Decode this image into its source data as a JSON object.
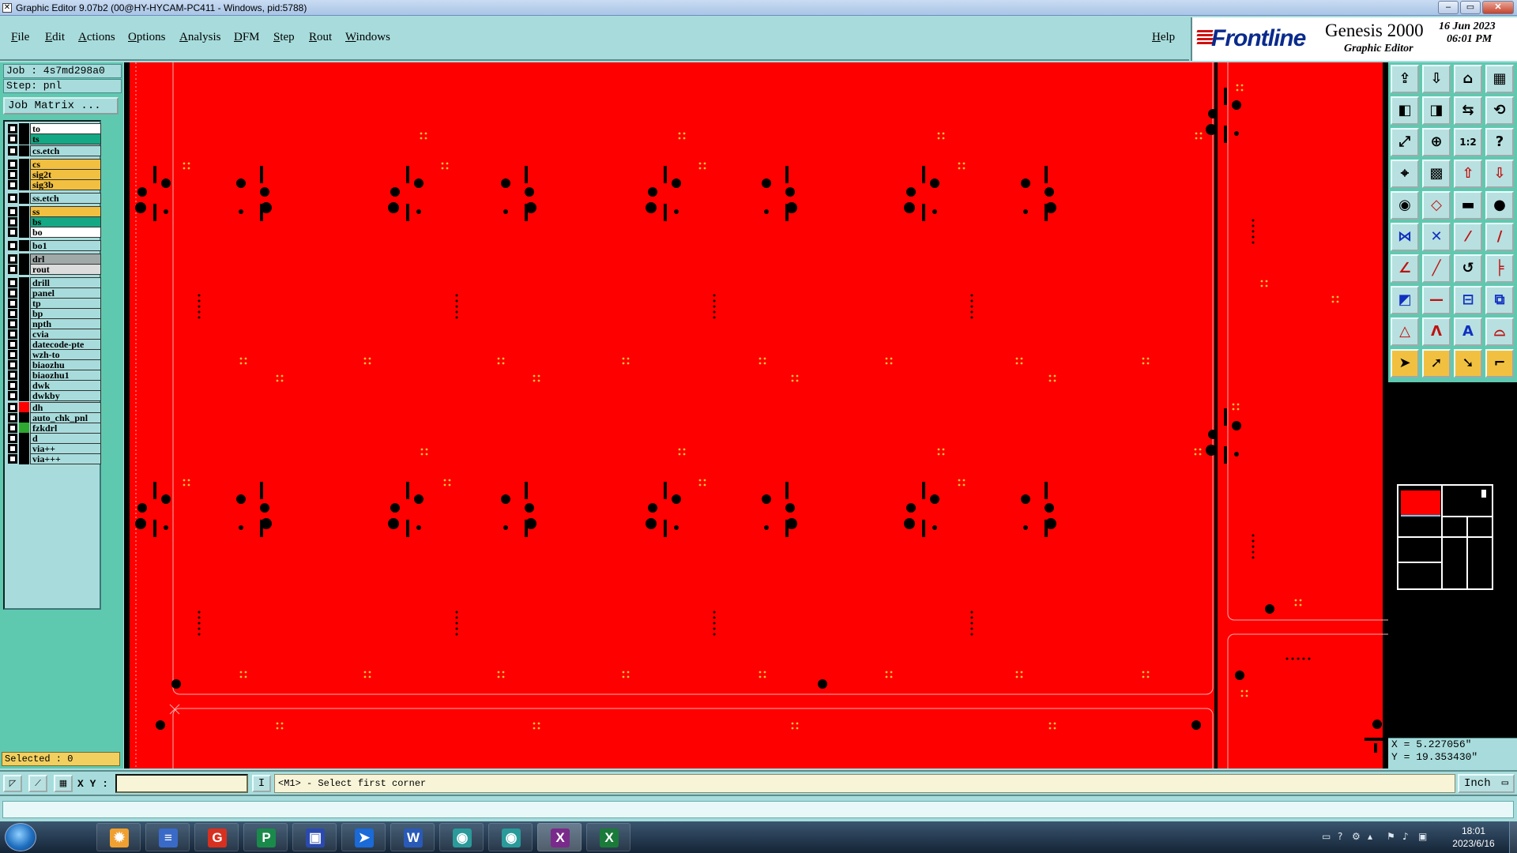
{
  "window": {
    "title": "Graphic Editor 9.07b2 (00@HY-HYCAM-PC411 - Windows, pid:5788)",
    "minimize_label": "–",
    "restore_label": "▭",
    "close_label": "✕"
  },
  "menu": {
    "items": [
      "File",
      "Edit",
      "Actions",
      "Options",
      "Analysis",
      "DFM",
      "Step",
      "Rout",
      "Windows"
    ],
    "help": "Help"
  },
  "branding": {
    "logo": "Frontline",
    "product": "Genesis 2000",
    "subtitle": "Graphic Editor",
    "date": "16 Jun 2023",
    "time": "06:01 PM"
  },
  "job": {
    "job_label": "Job : 4s7md298a0",
    "step_label": "Step: pnl",
    "matrix_button": "Job Matrix ...",
    "selected": "Selected : 0"
  },
  "layers": [
    {
      "name": "to",
      "bg": "#ffffff",
      "swatch": "#000000"
    },
    {
      "name": "ts",
      "bg": "#14a884",
      "swatch": "#000000"
    },
    {
      "name": "cs.etch",
      "bg": "#a8dcdc",
      "swatch": "#000000"
    },
    {
      "name": "cs",
      "bg": "#f2c040",
      "swatch": "#000000"
    },
    {
      "name": "sig2t",
      "bg": "#f2c040",
      "swatch": "#000000"
    },
    {
      "name": "sig3b",
      "bg": "#f2c040",
      "swatch": "#000000"
    },
    {
      "name": "ss.etch",
      "bg": "#a8dcdc",
      "swatch": "#000000"
    },
    {
      "name": "ss",
      "bg": "#f2c040",
      "swatch": "#000000"
    },
    {
      "name": "bs",
      "bg": "#14a884",
      "swatch": "#000000"
    },
    {
      "name": "bo",
      "bg": "#ffffff",
      "swatch": "#000000"
    },
    {
      "name": "bo1",
      "bg": "#a8dcdc",
      "swatch": "#000000"
    },
    {
      "name": "drl",
      "bg": "#a0a8a8",
      "swatch": "#000000"
    },
    {
      "name": "rout",
      "bg": "#dcdcdc",
      "swatch": "#000000"
    },
    {
      "name": "drill",
      "bg": "#a8dcdc",
      "swatch": "#000000"
    },
    {
      "name": "panel",
      "bg": "#a8dcdc",
      "swatch": "#000000"
    },
    {
      "name": "tp",
      "bg": "#a8dcdc",
      "swatch": "#000000"
    },
    {
      "name": "bp",
      "bg": "#a8dcdc",
      "swatch": "#000000"
    },
    {
      "name": "npth",
      "bg": "#a8dcdc",
      "swatch": "#000000"
    },
    {
      "name": "cvia",
      "bg": "#a8dcdc",
      "swatch": "#000000"
    },
    {
      "name": "datecode-pte",
      "bg": "#a8dcdc",
      "swatch": "#000000"
    },
    {
      "name": "wzh-to",
      "bg": "#a8dcdc",
      "swatch": "#000000"
    },
    {
      "name": "biaozhu",
      "bg": "#a8dcdc",
      "swatch": "#000000"
    },
    {
      "name": "biaozhu1",
      "bg": "#a8dcdc",
      "swatch": "#000000"
    },
    {
      "name": "dwk",
      "bg": "#a8dcdc",
      "swatch": "#000000"
    },
    {
      "name": "dwkby",
      "bg": "#a8dcdc",
      "swatch": "#000000"
    },
    {
      "name": "dh",
      "bg": "#a8dcdc",
      "swatch": "#ff0000"
    },
    {
      "name": "auto_chk_pnl",
      "bg": "#a8dcdc",
      "swatch": "#000000"
    },
    {
      "name": "fzkdrl",
      "bg": "#a8dcdc",
      "swatch": "#2ea82e"
    },
    {
      "name": "d",
      "bg": "#a8dcdc",
      "swatch": "#000000"
    },
    {
      "name": "via++",
      "bg": "#a8dcdc",
      "swatch": "#000000"
    },
    {
      "name": "via+++",
      "bg": "#a8dcdc",
      "swatch": "#000000"
    }
  ],
  "canvas": {
    "fill_color": "#ff0000",
    "background": "#000000",
    "accent_dots": "#f2c040"
  },
  "tools": [
    "open-icon",
    "save-icon",
    "home-icon",
    "window-icon",
    "prev-icon",
    "next-icon",
    "flip-icon",
    "rotate-icon",
    "fit-icon",
    "zoom-fit-icon",
    "scale-1-2-icon",
    "help-icon",
    "snap-icon",
    "grid-icon",
    "layers-up-icon",
    "layers-down-icon",
    "camera-icon",
    "select-box-icon",
    "ruler-icon",
    "pad-icon",
    "connect-icon",
    "cross-icon",
    "point-icon",
    "line-point-icon",
    "measure-angle-icon",
    "line-icon",
    "arc-icon",
    "text-icon",
    "box-icon",
    "minus-icon",
    "dimension-icon",
    "step-icon",
    "triangle-icon",
    "a-outline-icon",
    "a-highlight-icon",
    "a-arc-icon",
    "pointer-icon",
    "pointer-select-icon",
    "pointer-move-icon",
    "pointer-snap-icon"
  ],
  "coords": {
    "x": "X = 5.227056\"",
    "y": "Y = 19.353430\""
  },
  "status": {
    "xy_label": "X Y :",
    "xy_value": "",
    "input_icon": "I",
    "prompt": "<M1> - Select first corner",
    "unit": "Inch",
    "message": ""
  },
  "taskbar": {
    "apps": [
      "shell",
      "notepad",
      "office-red",
      "publisher",
      "save-disk",
      "arrow-app",
      "word",
      "genesis-eye",
      "genesis-eye-2",
      "x-app",
      "excel"
    ],
    "time": "18:01",
    "date": "2023/6/16"
  }
}
